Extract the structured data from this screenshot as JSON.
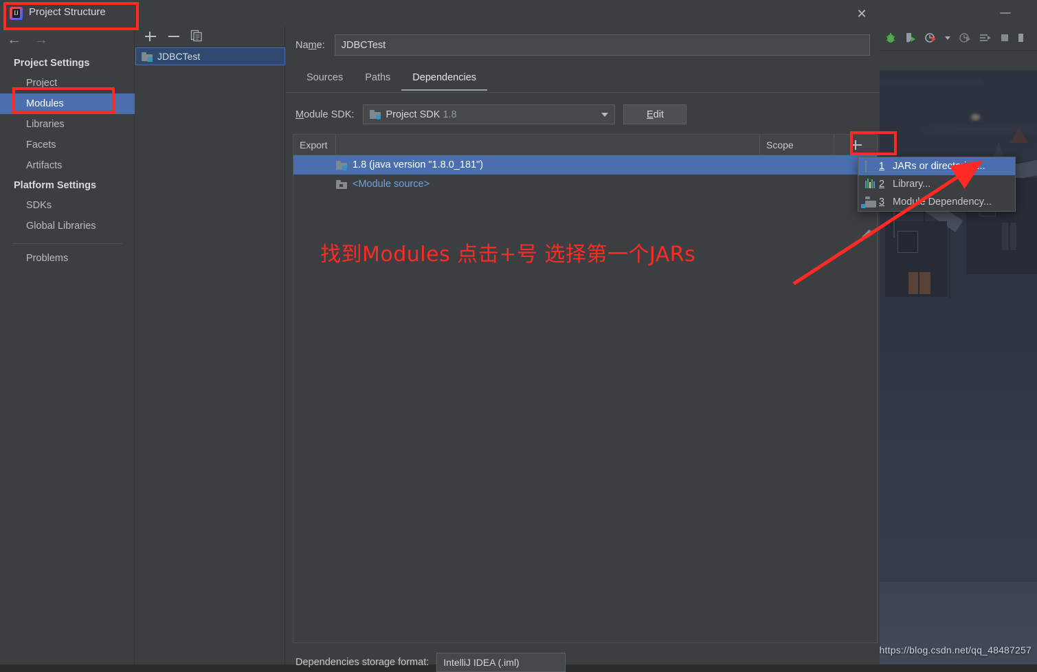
{
  "ide": {
    "minimize_label": "—",
    "toolbar_icons": [
      "debug-bug-icon",
      "coverage-run-icon",
      "profiler-run-icon",
      "dropdown-caret-icon",
      "run-with-icon",
      "run-list-icon",
      "stop-icon",
      "sidebar-toggle-icon"
    ],
    "watermark": "https://blog.csdn.net/qq_48487257"
  },
  "dialog": {
    "title": "Project Structure",
    "app_icon": "intellij-idea-icon",
    "close_label": "✕",
    "nav": {
      "back_label": "←",
      "forward_label": "→",
      "groups": [
        {
          "label": "Project Settings",
          "items": [
            {
              "label": "Project",
              "selected": false
            },
            {
              "label": "Modules",
              "selected": true
            },
            {
              "label": "Libraries",
              "selected": false
            },
            {
              "label": "Facets",
              "selected": false
            },
            {
              "label": "Artifacts",
              "selected": false
            }
          ]
        },
        {
          "label": "Platform Settings",
          "items": [
            {
              "label": "SDKs",
              "selected": false
            },
            {
              "label": "Global Libraries",
              "selected": false
            }
          ]
        }
      ],
      "footer_items": [
        {
          "label": "Problems",
          "selected": false
        }
      ]
    },
    "modules_panel": {
      "toolbar": {
        "add_label": "+",
        "remove_label": "−",
        "copy_label": "❐"
      },
      "items": [
        {
          "label": "JDBCTest",
          "selected": true
        }
      ]
    },
    "main": {
      "name_label": "Name:",
      "name_label_mnemonic": "m",
      "name_value": "JDBCTest",
      "tabs": [
        {
          "label": "Sources",
          "active": false
        },
        {
          "label": "Paths",
          "active": false
        },
        {
          "label": "Dependencies",
          "active": true
        }
      ],
      "sdk_label": "Module SDK:",
      "sdk_value": "Project SDK",
      "sdk_value_dim": "1.8",
      "edit_button": "Edit",
      "table": {
        "headers": {
          "export": "Export",
          "middle": "",
          "scope": "Scope",
          "add": "+"
        },
        "rows": [
          {
            "label": "1.8 (java version \"1.8.0_181\")",
            "icon": "sdk-folder-icon",
            "selected": true
          },
          {
            "label": "<Module source>",
            "icon": "module-source-icon",
            "selected": false
          }
        ]
      },
      "storage_label": "Dependencies storage format:",
      "storage_value": "IntelliJ IDEA (.iml)",
      "edit_pencil_icon": "pencil-edit-icon"
    },
    "context_menu": {
      "items": [
        {
          "mnemonic": "1",
          "label": "JARs or directories...",
          "icon": "jar-file-icon",
          "highlighted": true
        },
        {
          "mnemonic": "2",
          "label": "Library...",
          "icon": "library-bars-icon",
          "highlighted": false
        },
        {
          "mnemonic": "3",
          "label": "Module Dependency...",
          "icon": "module-folder-icon",
          "highlighted": false
        }
      ]
    }
  },
  "annotations": {
    "instruction_text": "找到Modules 点击+号 选择第一个JARs",
    "color": "#ff2a23",
    "boxes": [
      "title-highlight-box",
      "modules-highlight-box",
      "plus-button-highlight-box"
    ],
    "arrow": "arrow-to-jars-menu-item"
  }
}
